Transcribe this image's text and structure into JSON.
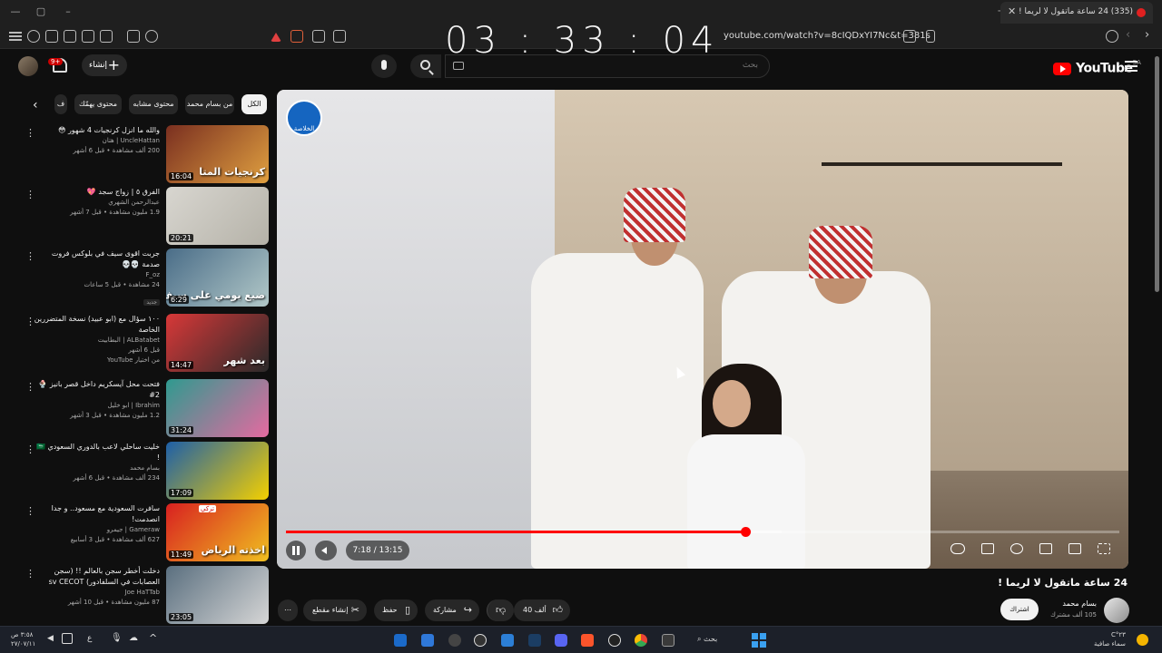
{
  "browser": {
    "tab_title": "(335) 24 ساعة ماتقول لا لريما !",
    "url": "youtube.com/watch?v=8cIQDxYI7Nc&t=381s",
    "clock_overlay": "03 : 33 : 04"
  },
  "header": {
    "logo_text": "YouTube",
    "logo_region": "SA",
    "search_placeholder": "بحث",
    "create_label": "إنشاء",
    "notification_count": "9+"
  },
  "chips": [
    {
      "label": "الكل",
      "active": true
    },
    {
      "label": "من بسام محمد",
      "active": false
    },
    {
      "label": "محتوى مشابه",
      "active": false
    },
    {
      "label": "محتوى يهمّك",
      "active": false
    },
    {
      "label": "ف",
      "active": false
    }
  ],
  "recommendations": [
    {
      "title": "والله ما انزل كرنجيات 4 شهور 😳",
      "channel": "UncleHattan | هتان",
      "views": "200 ألف مشاهدة • قبل 6 أشهر",
      "duration": "16:04",
      "thumb_text": "كرنجيات المتا",
      "tag": "",
      "colors": [
        "#7a2f20",
        "#e0a040"
      ]
    },
    {
      "title": "الفرق ٥ | زواج سجد 💖",
      "channel": "عبدالرحمن الشهري",
      "views": "1.9 مليون مشاهدة • قبل 7 أشهر",
      "duration": "20:21",
      "thumb_text": "",
      "tag": "",
      "colors": [
        "#d8d6d0",
        "#b5b2a8"
      ]
    },
    {
      "title": "جربت اقوى سيف في بلوكس فروت صدمة 💀💀",
      "channel": "F_oz",
      "views": "24 مشاهدة • قبل 5 ساعات",
      "duration": "6:29",
      "thumb_text": "ضيع يومي على سيف المرساة",
      "tag": "جديد",
      "colors": [
        "#4a6d88",
        "#b2c8c8"
      ]
    },
    {
      "title": "١٠٠ سؤال مع (ابو عبيد) نسخة المتضررين الخاصة",
      "channel": "ALBatabet | البطابيت",
      "views": "قبل 6 أشهر",
      "extra": "من اختيار YouTube",
      "duration": "14:47",
      "thumb_text": "بعد شهر",
      "tag": "",
      "colors": [
        "#d83838",
        "#2a2a2a"
      ]
    },
    {
      "title": "فتحت محل آيسكريم داخل قصر بانيز 🍨 2#",
      "channel": "Ibrahim | ابو خليل",
      "views": "1.2 مليون مشاهدة • قبل 3 أشهر",
      "duration": "31:24",
      "thumb_text": "",
      "tag": "",
      "colors": [
        "#2f9a8f",
        "#e46aa0"
      ]
    },
    {
      "title": "خليت ساحلي لاعب بالدوري السعودي 🇸🇦 !",
      "channel": "بسام محمد",
      "views": "234 ألف مشاهدة • قبل 6 أشهر",
      "duration": "17:09",
      "thumb_text": "",
      "tag": "",
      "colors": [
        "#1d5fa8",
        "#f4d000"
      ]
    },
    {
      "title": "سافرت السعودية مع مسعود.. و جدا انصدمت!",
      "channel": "Gameraw | جيمرو",
      "views": "627 ألف مشاهدة • قبل 3 أسابيع",
      "duration": "11:49",
      "thumb_text": "اخذته الرياض",
      "tag": "تركي",
      "colors": [
        "#d82020",
        "#f0c020"
      ]
    },
    {
      "title": "دخلت أخطر سجن بالعالم !! (سجن العصابات في السلفادور) sv CECOT",
      "channel": "Joe HaTTab",
      "views": "87 مليون مشاهدة • قبل 10 أشهر",
      "duration": "23:05",
      "thumb_text": "",
      "tag": "",
      "colors": [
        "#5a6f7f",
        "#d6d6d6"
      ]
    }
  ],
  "player": {
    "channel_badge": "الخلاصة",
    "current_time": "7:18",
    "duration": "13:15",
    "time_label": "7:18 / 13:15",
    "progress": 0.551,
    "buffered": 0.595
  },
  "video": {
    "title": "24 ساعة ماتقول لا لريما !",
    "owner": "بسام محمد",
    "subscribers": "105 ألف مشترك",
    "subscribe_label": "اشتراك",
    "likes": "40 ألف",
    "share_label": "مشاركة",
    "save_label": "حفظ",
    "clip_label": "إنشاء مقطع"
  },
  "taskbar": {
    "search_label": "بحث",
    "weather_temp": "٢٣°C",
    "weather_desc": "سماء صافية",
    "time": "٣:٥٨ ص",
    "date": "٢٧/٠٧/١١"
  },
  "colors": {
    "accent": "#ff0000",
    "background": "#0f0f0f",
    "chip": "#272727"
  }
}
